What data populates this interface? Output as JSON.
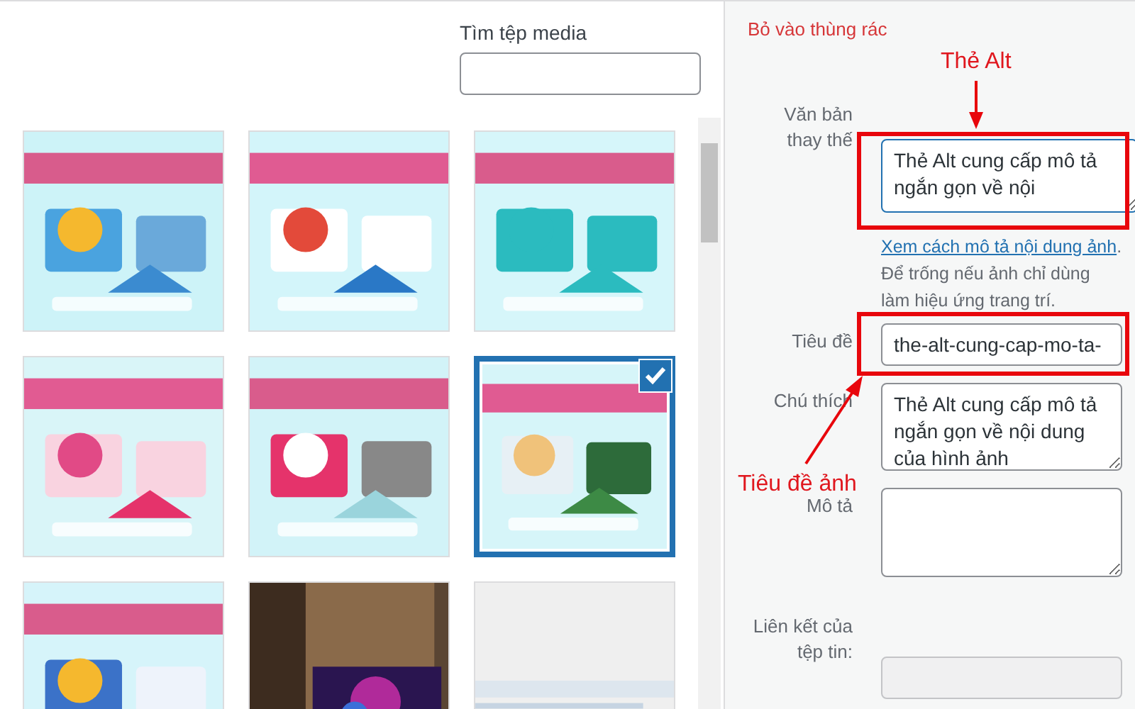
{
  "search": {
    "label": "Tìm tệp media"
  },
  "media": [
    {
      "kind": "picture",
      "selected": false
    },
    {
      "kind": "picture",
      "selected": false
    },
    {
      "kind": "picture",
      "selected": false
    },
    {
      "kind": "picture",
      "selected": false
    },
    {
      "kind": "picture",
      "selected": false
    },
    {
      "kind": "picture",
      "selected": true
    },
    {
      "kind": "picture",
      "selected": false
    },
    {
      "kind": "picture",
      "selected": false
    },
    {
      "kind": "picture",
      "selected": false
    }
  ],
  "details": {
    "trash_link": "Bỏ vào thùng rác",
    "alt_text": {
      "label": "Văn bản thay thế",
      "value": "Thẻ Alt cung cấp mô tả ngắn gọn về nội",
      "help_link": "Xem cách mô tả nội dung ảnh",
      "help_text": ". Để trống nếu ảnh chỉ dùng làm hiệu ứng trang trí."
    },
    "title": {
      "label": "Tiêu đề",
      "value": "the-alt-cung-cap-mo-ta-"
    },
    "caption": {
      "label": "Chú thích",
      "value": "Thẻ Alt cung cấp mô tả ngắn gọn về nội dung của hình ảnh"
    },
    "description": {
      "label": "Mô tả"
    },
    "file_url": {
      "label": "Liên kết của tệp tin:",
      "disabled": true
    }
  },
  "annotations": [
    {
      "text": "Thẻ Alt"
    },
    {
      "text": "Tiêu đề ảnh"
    }
  ]
}
